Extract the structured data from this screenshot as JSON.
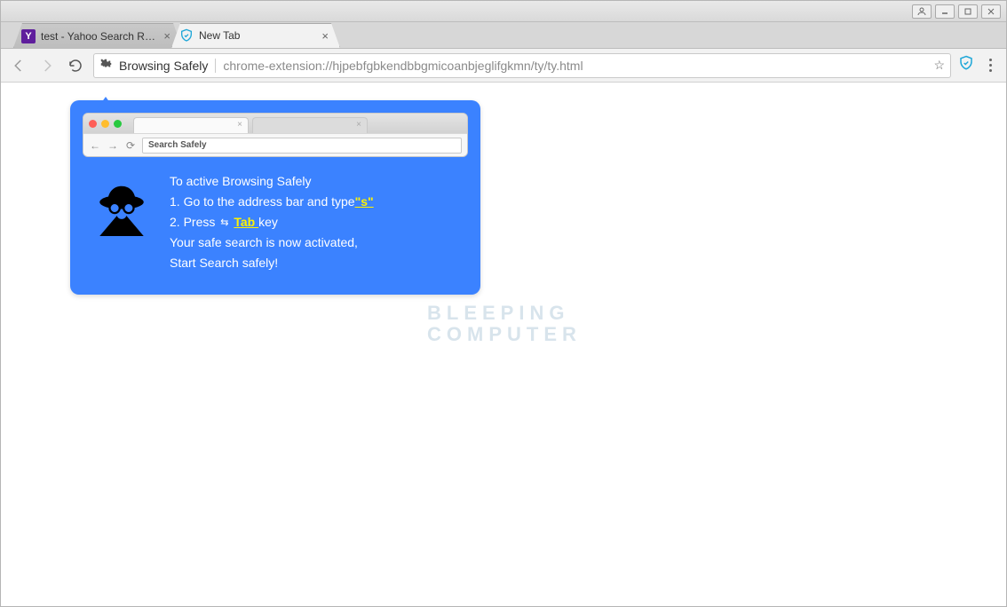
{
  "titlebar": {
    "icons": [
      "user",
      "min",
      "max",
      "close"
    ]
  },
  "tabs": [
    {
      "title": "test - Yahoo Search Resu",
      "favicon": "Y",
      "active": false
    },
    {
      "title": "New Tab",
      "favicon": "shield",
      "active": true
    }
  ],
  "toolbar": {
    "ext_name": "Browsing Safely",
    "url": "chrome-extension://hjpebfgbkendbbgmicoanbjeglifgkmn/ty/ty.html"
  },
  "callout": {
    "mock_input": "Search Safely",
    "heading": "To active Browsing Safely",
    "step1_pre": "1. Go to the address bar and type",
    "step1_hl": "\"s\"",
    "step2_pre": "2. Press ",
    "step2_hl": "Tab ",
    "step2_post": "key",
    "line3": "Your safe search is now activated,",
    "line4": "Start Search safely!"
  },
  "watermark": {
    "l1": "BLEEPING",
    "l2": "COMPUTER"
  }
}
